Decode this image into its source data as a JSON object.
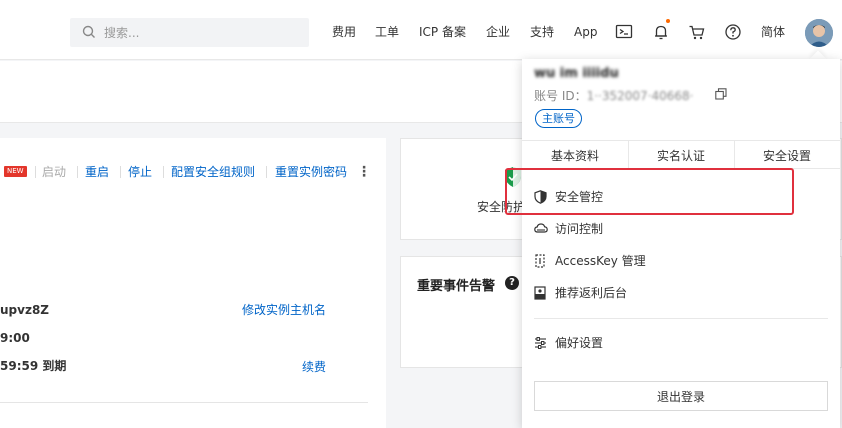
{
  "header": {
    "search_placeholder": "搜索...",
    "nav": [
      "费用",
      "工单",
      "ICP 备案",
      "企业",
      "支持",
      "App"
    ],
    "lang": "简体",
    "icons": [
      "terminal-icon",
      "bell-icon",
      "cart-icon",
      "help-icon"
    ]
  },
  "instance": {
    "new_badge": "NEW",
    "actions": [
      "启动",
      "重启",
      "停止",
      "配置安全组规则",
      "重置实例密码"
    ],
    "more": "⋮",
    "host_suffix": "upvz8Z",
    "time_suffix": "9:00",
    "expire_text": "59:59 到期",
    "rename_link": "修改实例主机名",
    "renew_link": "续费"
  },
  "cards": {
    "security_text": "安全防护",
    "alarm_title": "重要事件告警"
  },
  "account": {
    "username": "wu im iiiidu",
    "id_label": "账号 ID：",
    "id_value": "1··352007·40668·",
    "role_tag": "主账号",
    "tabs": [
      "基本资料",
      "实名认证",
      "安全设置"
    ],
    "menu": [
      {
        "label": "安全管控",
        "icon": "shield-icon"
      },
      {
        "label": "访问控制",
        "icon": "cloud-icon"
      },
      {
        "label": "AccessKey 管理",
        "icon": "key-icon"
      },
      {
        "label": "推荐返利后台",
        "icon": "gift-icon"
      },
      {
        "label": "偏好设置",
        "icon": "sliders-icon"
      }
    ],
    "logout": "退出登录"
  },
  "colors": {
    "link": "#0064c8",
    "highlight": "#e0303d",
    "badge": "#e3362b",
    "notify_dot": "#ff6a00"
  }
}
